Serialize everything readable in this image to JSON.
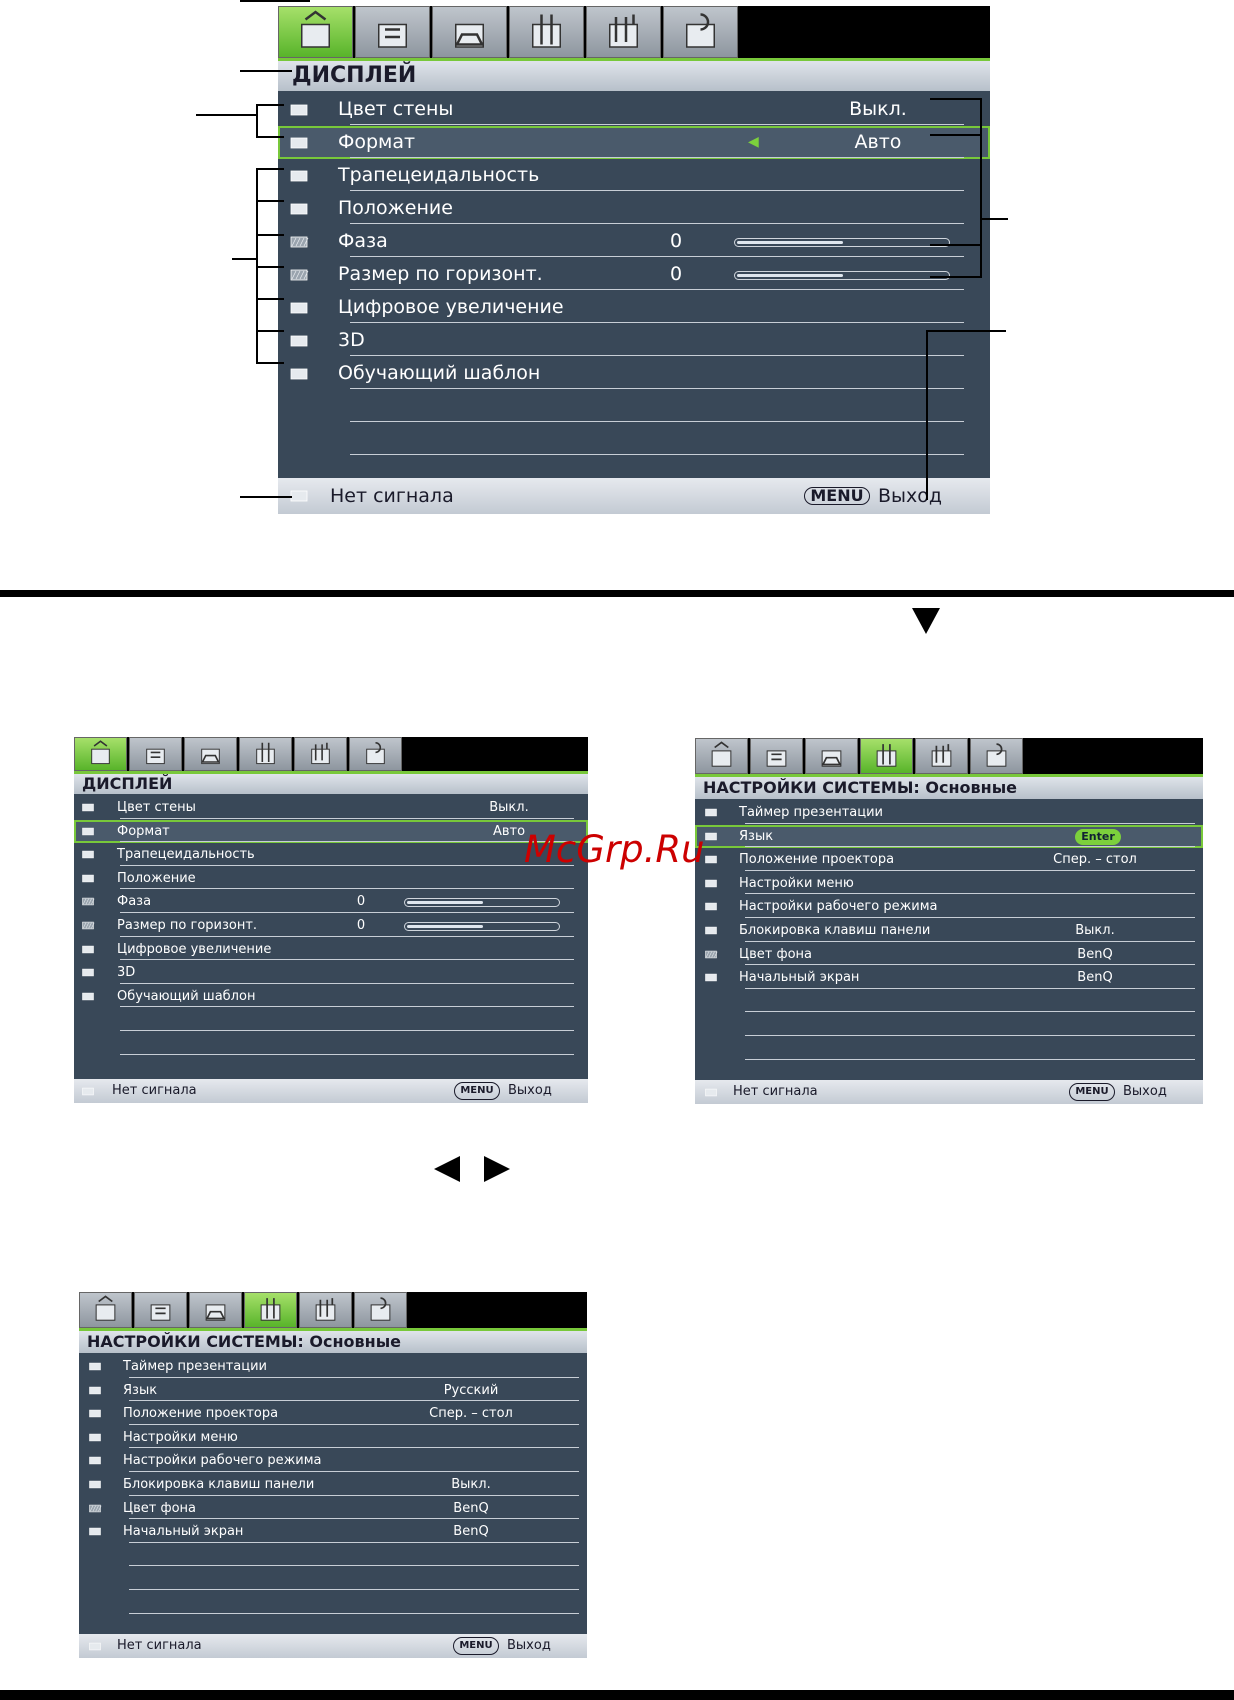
{
  "tab_icons": [
    "picture-tab-icon",
    "picture-advanced-tab-icon",
    "display-tab-icon",
    "system-basic-tab-icon",
    "system-advanced-tab-icon",
    "information-tab-icon"
  ],
  "display_menu": {
    "title": "ДИСПЛЕЙ",
    "rows": [
      {
        "label": "Цвет стены",
        "value": "Выкл.",
        "icon": "wall-color-icon"
      },
      {
        "label": "Формат",
        "value": "Авто",
        "icon": "aspect-ratio-icon"
      },
      {
        "label": "Трапецеидальность",
        "value": "",
        "icon": "keystone-icon"
      },
      {
        "label": "Положение",
        "value": "",
        "icon": "position-icon"
      },
      {
        "label": "Фаза",
        "value": "0",
        "icon": "phase-icon",
        "slider": 0.5
      },
      {
        "label": "Размер по горизонт.",
        "value": "0",
        "icon": "h-size-icon",
        "slider": 0.5
      },
      {
        "label": "Цифровое увеличение",
        "value": "",
        "icon": "digital-zoom-icon"
      },
      {
        "label": "3D",
        "value": "",
        "icon": "3d-icon"
      },
      {
        "label": "Обучающий шаблон",
        "value": "",
        "icon": "teaching-template-icon"
      }
    ],
    "selected_index": 1,
    "footer": {
      "source": "Нет сигнала",
      "menu_key": "MENU",
      "exit": "Выход"
    }
  },
  "system_menu_a": {
    "title": "НАСТРОЙКИ СИСТЕМЫ: Основные",
    "rows": [
      {
        "label": "Таймер презентации",
        "value": "",
        "icon": "presentation-timer-icon"
      },
      {
        "label": "Язык",
        "value": "",
        "icon": "language-icon",
        "badge": "Enter"
      },
      {
        "label": "Положение проектора",
        "value": "Спер. – стол",
        "icon": "projector-position-icon"
      },
      {
        "label": "Настройки меню",
        "value": "",
        "icon": "menu-settings-icon"
      },
      {
        "label": "Настройки рабочего режима",
        "value": "",
        "icon": "operation-settings-icon"
      },
      {
        "label": "Блокировка клавиш панели",
        "value": "Выкл.",
        "icon": "panel-key-lock-icon"
      },
      {
        "label": "Цвет фона",
        "value": "BenQ",
        "icon": "background-color-icon"
      },
      {
        "label": "Начальный экран",
        "value": "BenQ",
        "icon": "splash-screen-icon"
      }
    ],
    "selected_index": 1,
    "footer": {
      "source": "Нет сигнала",
      "menu_key": "MENU",
      "exit": "Выход"
    }
  },
  "system_menu_b": {
    "title": "НАСТРОЙКИ СИСТЕМЫ: Основные",
    "rows": [
      {
        "label": "Таймер презентации",
        "value": "",
        "icon": "presentation-timer-icon"
      },
      {
        "label": "Язык",
        "value": "Русский",
        "icon": "language-icon"
      },
      {
        "label": "Положение проектора",
        "value": "Спер. – стол",
        "icon": "projector-position-icon"
      },
      {
        "label": "Настройки меню",
        "value": "",
        "icon": "menu-settings-icon"
      },
      {
        "label": "Настройки рабочего режима",
        "value": "",
        "icon": "operation-settings-icon"
      },
      {
        "label": "Блокировка клавиш панели",
        "value": "Выкл.",
        "icon": "panel-key-lock-icon"
      },
      {
        "label": "Цвет фона",
        "value": "BenQ",
        "icon": "background-color-icon"
      },
      {
        "label": "Начальный экран",
        "value": "BenQ",
        "icon": "splash-screen-icon"
      }
    ],
    "selected_index": -1,
    "footer": {
      "source": "Нет сигнала",
      "menu_key": "MENU",
      "exit": "Выход"
    }
  },
  "watermark": "McGrp.Ru",
  "colors": {
    "osd_bg": "#394858",
    "accent_green": "#78c83a",
    "title_bg": "#c9d0d8"
  }
}
